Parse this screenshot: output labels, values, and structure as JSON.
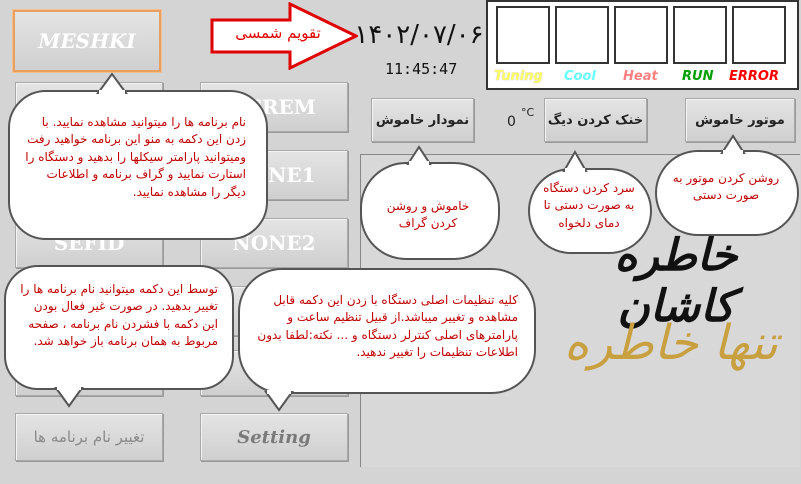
{
  "left_buttons": {
    "meshki": "MESHKI",
    "serem": "SEREM",
    "none1": "NONE1",
    "sefid": "SEFID",
    "none2": "NONE2",
    "rename": "تغییر نام برنامه ها",
    "setting": "Setting"
  },
  "header": {
    "calendar_label": "تقویم شمسی",
    "date": "۱۴۰۲/۰۷/۰۶",
    "time": "11:45:47"
  },
  "status_labels": {
    "tuning": "Tuning",
    "cool": "Cool",
    "heat": "Heat",
    "run": "RUN",
    "error": "ERROR"
  },
  "status_colors": {
    "tuning": "#ffff66",
    "cool": "#66ffff",
    "heat": "#ff8080",
    "run": "#00a000",
    "error": "#ff0000"
  },
  "control_buttons": {
    "graph_off": "نمودار خاموش",
    "boiler_cooling": "خنک کردن دیگ",
    "motor_off": "موتور خاموش"
  },
  "temperature": {
    "value": "0",
    "unit": "°C"
  },
  "tooltips": {
    "programs": "نام برنامه ها را میتوانید مشاهده نمایید. با زدن این دکمه به منو این برنامه خواهید رفت ومیتوانید پارامتر سیکلها را بدهید و دستگاه را استارت نمایید و گراف برنامه و اطلاعات دیگر را مشاهده نمایید.",
    "rename": "توسط این دکمه میتوانید نام برنامه ها را تغییر بدهید. در صورت غیر فعال بودن این دکمه با فشردن نام برنامه ، صفحه مربوط به همان برنامه باز خواهد شد.",
    "graph": "خاموش و روشن کردن گراف",
    "cooling": "سرد کردن دستگاه به صورت دستی تا دمای دلخواه",
    "motor": "روشن کردن موتور به صورت دستی",
    "settings": "کلیه تنظیمات اصلی دستگاه با زدن این دکمه قابل مشاهده و تغییر میباشد.از قبیل تنظیم ساعت و پارامترهای اصلی کنترلر دستگاه و ... نکته:لطفا بدون اطلاعات تنظیمات را تغییر ندهید."
  },
  "calligraphy": {
    "line1": "خاطره کاشان",
    "line2": "تنها خاطره"
  }
}
